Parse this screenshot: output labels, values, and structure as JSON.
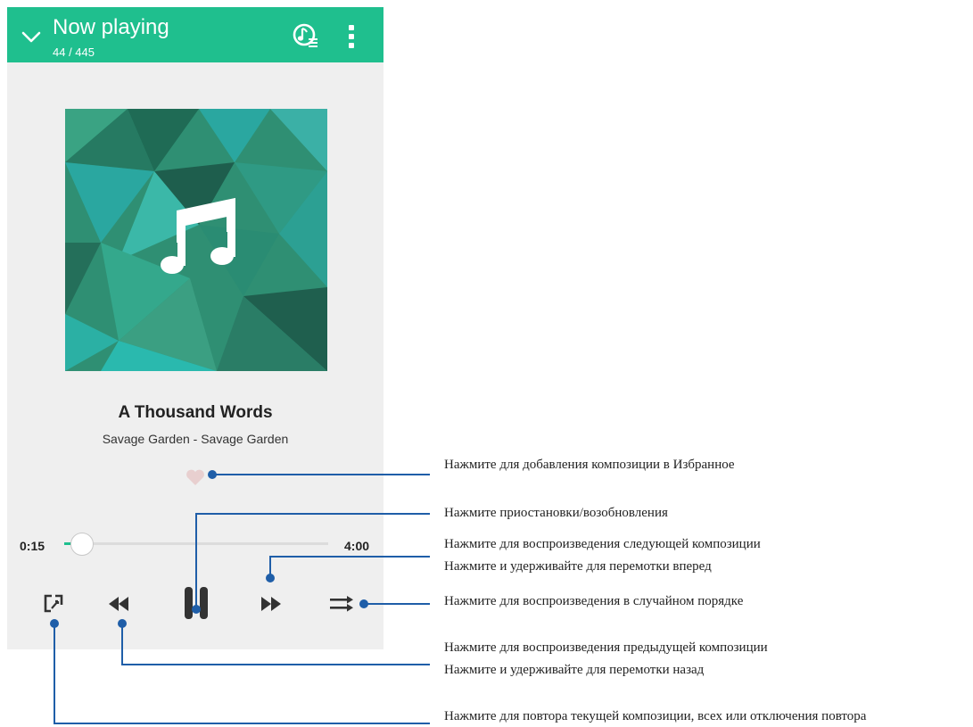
{
  "header": {
    "title": "Now playing",
    "track_counter": "44 / 445",
    "icons": [
      "chevron-down-icon",
      "queue-music-icon",
      "more-vert-icon"
    ]
  },
  "track": {
    "title": "A Thousand Words",
    "artist_album": "Savage Garden - Savage Garden"
  },
  "playback": {
    "elapsed": "0:15",
    "duration": "4:00",
    "progress": 0.0625
  },
  "controls": [
    "repeat-icon",
    "rewind-icon",
    "pause-icon",
    "fast-forward-icon",
    "shuffle-icon"
  ],
  "annotations": {
    "favorite": "Нажмите для добавления композиции в Избранное",
    "pause": "Нажмите приостановки/возобновления",
    "next_1": "Нажмите для воспроизведения следующей композиции",
    "next_2": "Нажмите и удерживайте для перемотки вперед",
    "shuffle": "Нажмите для воспроизведения в случайном порядке",
    "prev_1": "Нажмите для воспроизведения предыдущей композиции",
    "prev_2": "Нажмите и удерживайте для перемотки назад",
    "repeat": "Нажмите для повтора текущей композиции, всех или отключения повтора"
  },
  "colors": {
    "accent": "#1fbf8e",
    "callout": "#1f5ea8",
    "heart": "#e8cfcf"
  }
}
